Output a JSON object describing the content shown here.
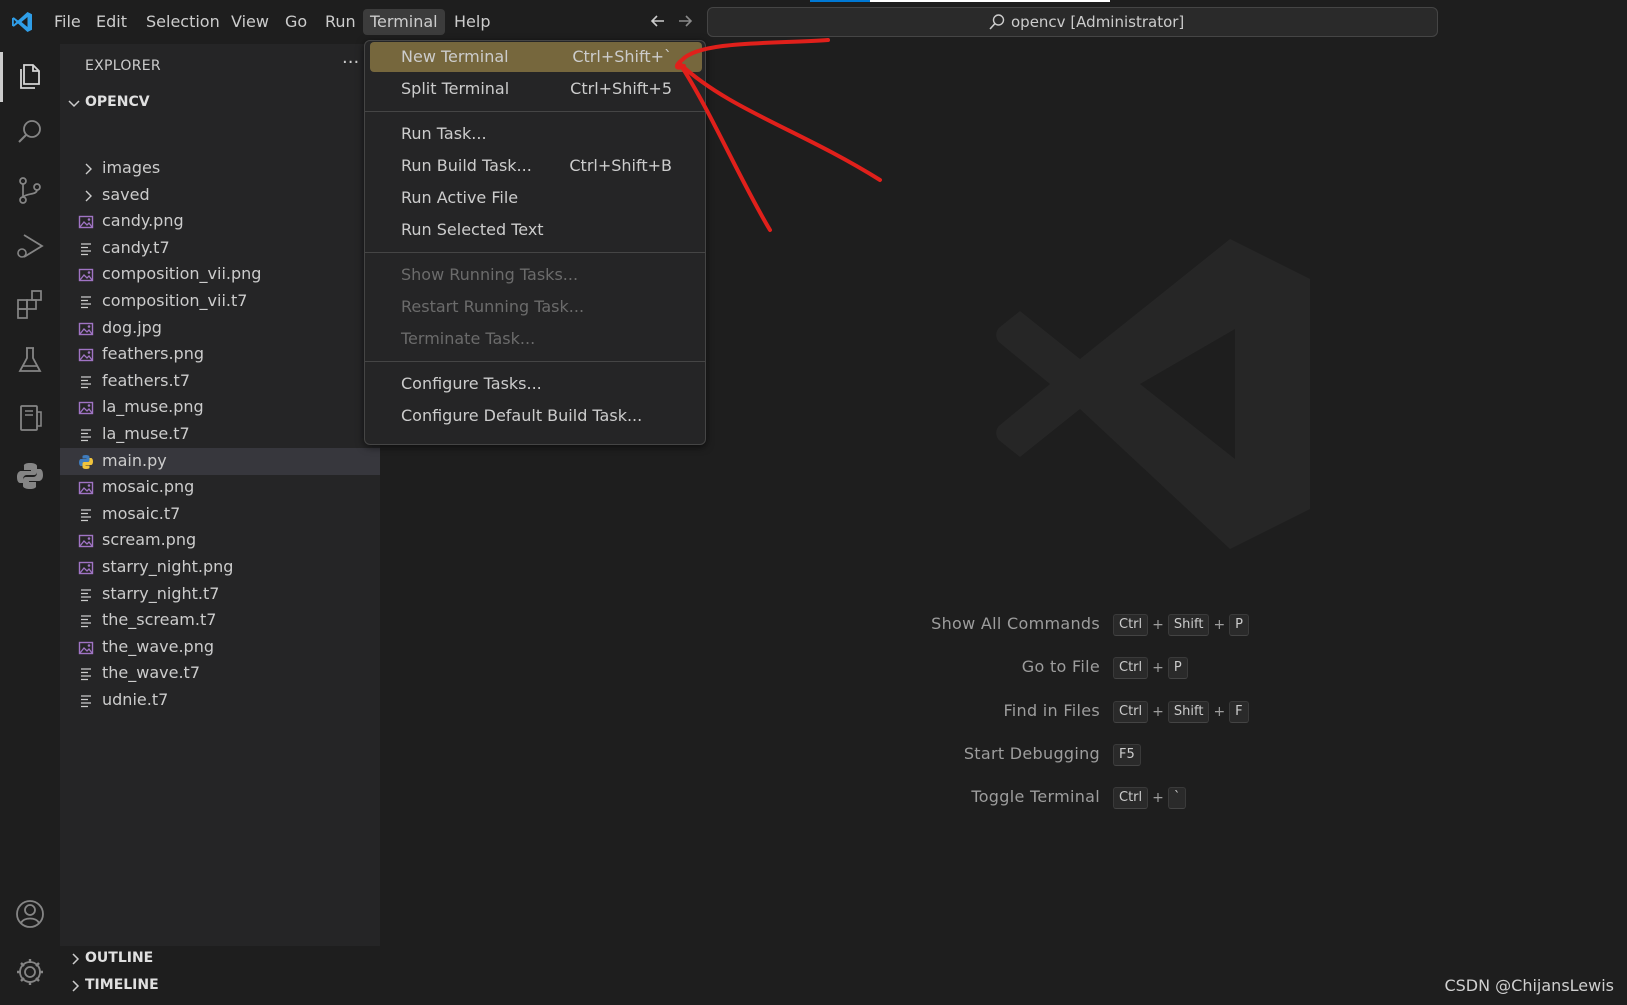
{
  "titlebar": {
    "menus": [
      "File",
      "Edit",
      "Selection",
      "View",
      "Go",
      "Run",
      "Terminal",
      "Help"
    ],
    "active_menu": "Terminal",
    "command_center": "opencv [Administrator]"
  },
  "activitybar": {
    "icons": [
      "explorer-icon",
      "search-icon",
      "source-control-icon",
      "run-debug-icon",
      "extensions-icon",
      "testing-icon",
      "remote-explorer-icon",
      "python-icon",
      "account-icon",
      "settings-gear-icon"
    ]
  },
  "sidebar": {
    "header": "EXPLORER",
    "more": "···",
    "folder": "OPENCV",
    "items": [
      {
        "label": "images",
        "type": "folder"
      },
      {
        "label": "saved",
        "type": "folder"
      },
      {
        "label": "candy.png",
        "type": "image"
      },
      {
        "label": "candy.t7",
        "type": "text"
      },
      {
        "label": "composition_vii.png",
        "type": "image"
      },
      {
        "label": "composition_vii.t7",
        "type": "text"
      },
      {
        "label": "dog.jpg",
        "type": "image"
      },
      {
        "label": "feathers.png",
        "type": "image"
      },
      {
        "label": "feathers.t7",
        "type": "text"
      },
      {
        "label": "la_muse.png",
        "type": "image"
      },
      {
        "label": "la_muse.t7",
        "type": "text"
      },
      {
        "label": "main.py",
        "type": "python",
        "selected": true
      },
      {
        "label": "mosaic.png",
        "type": "image"
      },
      {
        "label": "mosaic.t7",
        "type": "text"
      },
      {
        "label": "scream.png",
        "type": "image"
      },
      {
        "label": "starry_night.png",
        "type": "image"
      },
      {
        "label": "starry_night.t7",
        "type": "text"
      },
      {
        "label": "the_scream.t7",
        "type": "text"
      },
      {
        "label": "the_wave.png",
        "type": "image"
      },
      {
        "label": "the_wave.t7",
        "type": "text"
      },
      {
        "label": "udnie.t7",
        "type": "text"
      }
    ],
    "outline": "OUTLINE",
    "timeline": "TIMELINE"
  },
  "terminal_menu": {
    "items": [
      {
        "label": "New Terminal",
        "key": "Ctrl+Shift+`",
        "highlight": true
      },
      {
        "label": "Split Terminal",
        "key": "Ctrl+Shift+5"
      },
      {
        "label": "Run Task...",
        "key": ""
      },
      {
        "label": "Run Build Task...",
        "key": "Ctrl+Shift+B"
      },
      {
        "label": "Run Active File",
        "key": ""
      },
      {
        "label": "Run Selected Text",
        "key": ""
      },
      {
        "label": "Show Running Tasks...",
        "key": "",
        "disabled": true
      },
      {
        "label": "Restart Running Task...",
        "key": "",
        "disabled": true
      },
      {
        "label": "Terminate Task...",
        "key": "",
        "disabled": true
      },
      {
        "label": "Configure Tasks...",
        "key": ""
      },
      {
        "label": "Configure Default Build Task...",
        "key": ""
      }
    ]
  },
  "editor": {
    "shortcuts": [
      {
        "label": "Show All Commands",
        "keys": [
          "Ctrl",
          "Shift",
          "P"
        ]
      },
      {
        "label": "Go to File",
        "keys": [
          "Ctrl",
          "P"
        ]
      },
      {
        "label": "Find in Files",
        "keys": [
          "Ctrl",
          "Shift",
          "F"
        ]
      },
      {
        "label": "Start Debugging",
        "keys": [
          "F5"
        ]
      },
      {
        "label": "Toggle Terminal",
        "keys": [
          "Ctrl",
          "`"
        ]
      }
    ]
  },
  "watermark": "CSDN @ChijansLewis",
  "colors": {
    "accent": "#0078d4",
    "menu_highlight": "#76673d",
    "annotation": "#e0201b"
  }
}
